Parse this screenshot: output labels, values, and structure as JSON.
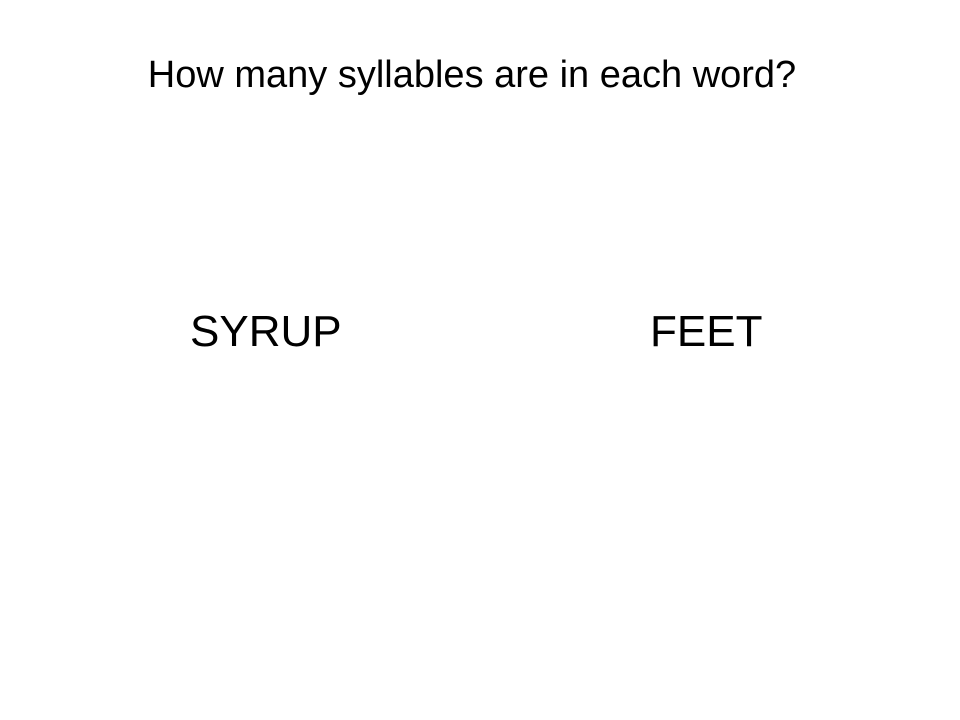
{
  "slide": {
    "title": "How many syllables are in each word?",
    "words": [
      "SYRUP",
      "FEET"
    ]
  }
}
